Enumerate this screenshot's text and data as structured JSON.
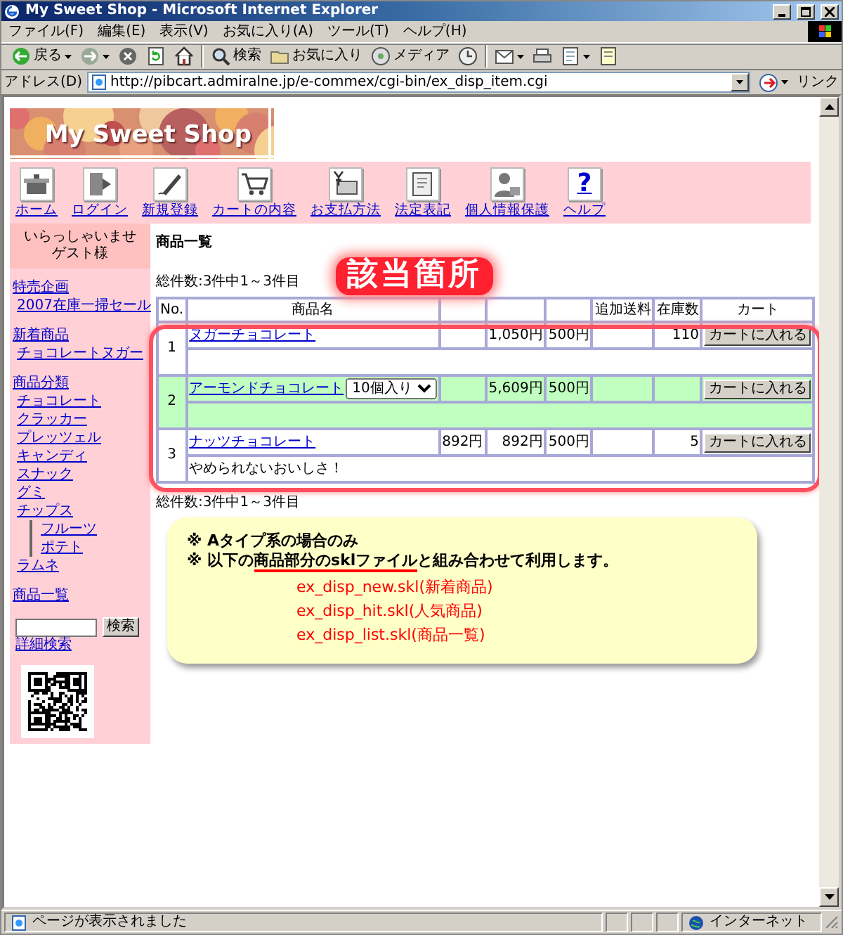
{
  "window": {
    "title": "My Sweet Shop - Microsoft Internet Explorer"
  },
  "menu": [
    "ファイル(F)",
    "編集(E)",
    "表示(V)",
    "お気に入り(A)",
    "ツール(T)",
    "ヘルプ(H)"
  ],
  "toolbar": [
    {
      "kind": "back",
      "label": "戻る",
      "dropdown": true
    },
    {
      "kind": "forward",
      "dropdown": true
    },
    {
      "kind": "stop"
    },
    {
      "kind": "refresh"
    },
    {
      "kind": "home"
    },
    {
      "kind": "separator"
    },
    {
      "kind": "search",
      "label": "検索"
    },
    {
      "kind": "favorites",
      "label": "お気に入り"
    },
    {
      "kind": "media",
      "label": "メディア"
    },
    {
      "kind": "history"
    },
    {
      "kind": "separator"
    },
    {
      "kind": "mail",
      "dropdown": true
    },
    {
      "kind": "print"
    },
    {
      "kind": "edit",
      "dropdown": true
    },
    {
      "kind": "discuss"
    }
  ],
  "address": {
    "label": "アドレス(D)",
    "value": "http://pibcart.admiralne.jp/e-commex/cgi-bin/ex_disp_item.cgi",
    "links": "リンク"
  },
  "page": {
    "logo": "My Sweet Shop",
    "nav": [
      {
        "kind": "home",
        "label": "ホーム"
      },
      {
        "kind": "login",
        "label": "ログイン"
      },
      {
        "kind": "register",
        "label": "新規登録"
      },
      {
        "kind": "cart",
        "label": "カートの内容"
      },
      {
        "kind": "payment",
        "label": "お支払方法"
      },
      {
        "kind": "legal",
        "label": "法定表記"
      },
      {
        "kind": "privacy",
        "label": "個人情報保護"
      },
      {
        "kind": "help",
        "label": "ヘルプ",
        "glyph": "?"
      }
    ],
    "sidebar": {
      "greeting": [
        "いらっしゃいませ",
        "ゲスト様"
      ],
      "sections": [
        {
          "title": "特売企画",
          "items": [
            {
              "label": "2007在庫一掃セール"
            }
          ]
        },
        {
          "title": "新着商品",
          "items": [
            {
              "label": "チョコレートヌガー"
            }
          ]
        },
        {
          "title": "商品分類",
          "items": [
            {
              "label": "チョコレート"
            },
            {
              "label": "クラッカー"
            },
            {
              "label": "プレッツェル"
            },
            {
              "label": "キャンディ"
            },
            {
              "label": "スナック"
            },
            {
              "label": "グミ"
            },
            {
              "label": "チップス",
              "children": [
                {
                  "label": "フルーツ"
                },
                {
                  "label": "ポテト"
                }
              ]
            },
            {
              "label": "ラムネ"
            }
          ]
        },
        {
          "title": "商品一覧"
        }
      ],
      "search": {
        "button": "検索",
        "link": "詳細検索"
      }
    },
    "heading": "商品一覧",
    "count_top": "総件数:3件中1～3件目",
    "header_left": [
      "No.",
      "商品名"
    ],
    "header_right": [
      "追加送料",
      "在庫数",
      "カート"
    ],
    "rows": [
      {
        "no": "1",
        "name": "ヌガーチョコレート",
        "column_4": "1,050円",
        "column_5": "500円",
        "stock": "110",
        "button": "カートに入れる",
        "highlight": false
      },
      {
        "no": "2",
        "name": "アーモンドチョコレート",
        "option": "10個入り",
        "column_4": "5,609円",
        "column_5": "500円",
        "button": "カートに入れる",
        "highlight": true
      },
      {
        "no": "3",
        "name": "ナッツチョコレート",
        "column_3": "892円",
        "column_4": "892円",
        "column_5": "500円",
        "stock": "5",
        "button": "カートに入れる",
        "comment": "やめられないおいしさ！",
        "highlight": false
      }
    ],
    "count_bottom": "総件数:3件中1～3件目",
    "callout": "該当箇所",
    "note": {
      "lines": [
        "※ Aタイプ系の場合のみ"
      ],
      "underlined_line": {
        "before": "※ 以下の",
        "underlined": "商品部分のsklファイル",
        "after": "と組み合わせて利用します。"
      },
      "files": [
        "ex_disp_new.skl(新着商品)",
        "ex_disp_hit.skl(人気商品)",
        "ex_disp_list.skl(商品一覧)"
      ]
    }
  },
  "status_bar": {
    "text": "ページが表示されました",
    "zone": "インターネット"
  }
}
